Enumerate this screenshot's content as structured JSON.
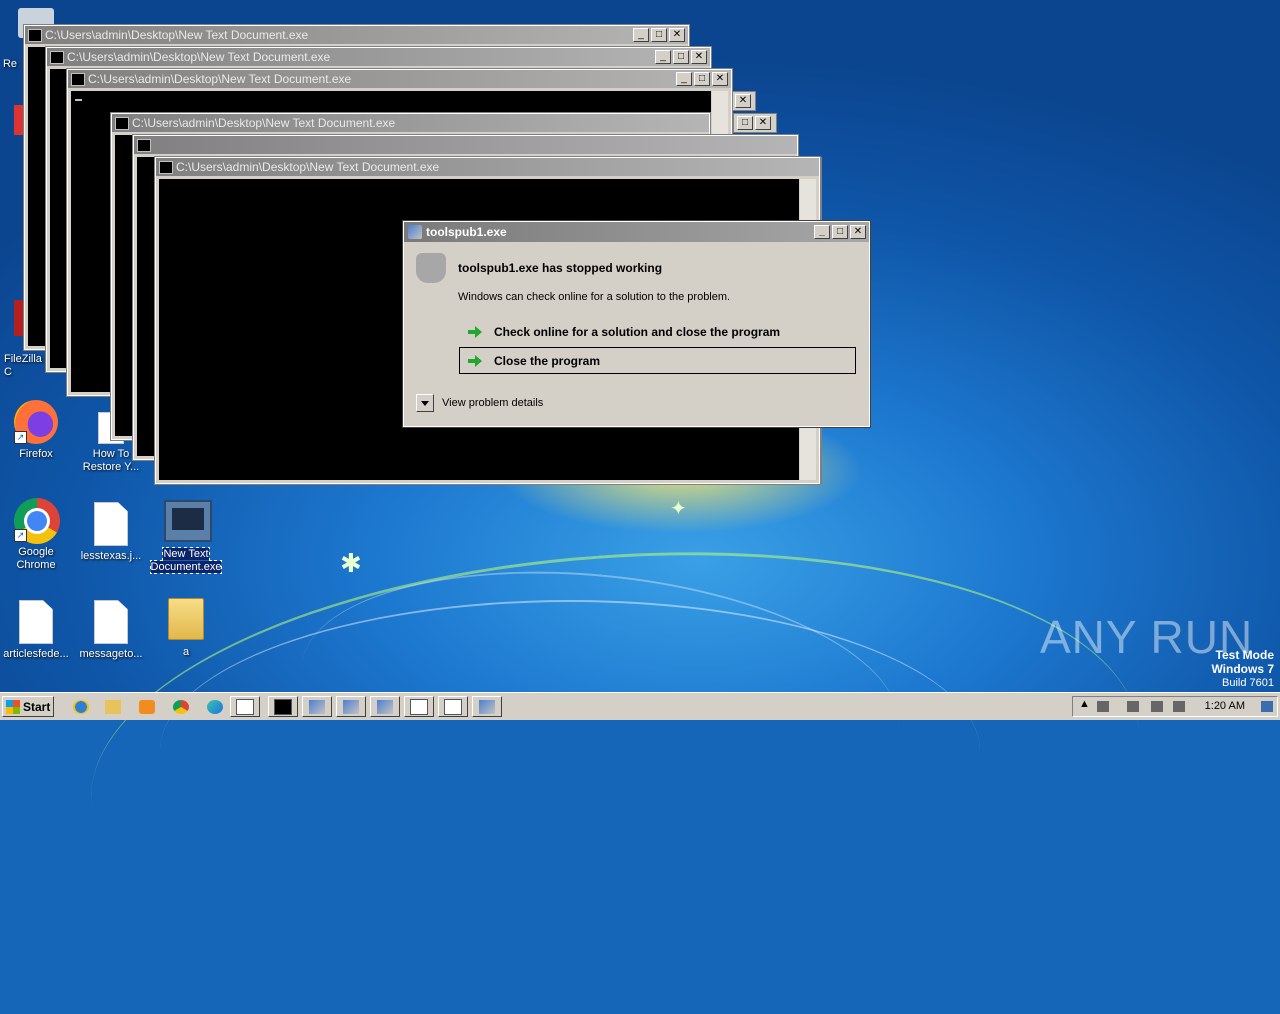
{
  "desktop": {
    "icons": [
      {
        "label": "Firefox"
      },
      {
        "label": "How To Restore Y..."
      },
      {
        "label": "Google Chrome"
      },
      {
        "label": "lesstexas.j..."
      },
      {
        "label": "New Text Document.exe"
      },
      {
        "label": "articlesfede..."
      },
      {
        "label": "messageto..."
      },
      {
        "label": "a"
      },
      {
        "label": "FileZilla C"
      },
      {
        "label": "Re"
      }
    ]
  },
  "console_title": "C:\\Users\\admin\\Desktop\\New Text Document.exe",
  "dialog": {
    "title": "toolspub1.exe",
    "heading": "toolspub1.exe has stopped working",
    "subtitle": "Windows can check online for a solution to the problem.",
    "option_check": "Check online for a solution and close the program",
    "option_close": "Close the program",
    "details": "View problem details"
  },
  "watermark": "ANY RUN",
  "os_info": {
    "line1": "Test Mode",
    "line2": "Windows 7",
    "line3": "Build 7601"
  },
  "taskbar": {
    "start_label": "Start",
    "clock": "1:20 AM"
  },
  "colors": {
    "desktop": "#1565b8",
    "dialog_bg": "#d4d0c8",
    "arrow_green": "#22a62e"
  }
}
